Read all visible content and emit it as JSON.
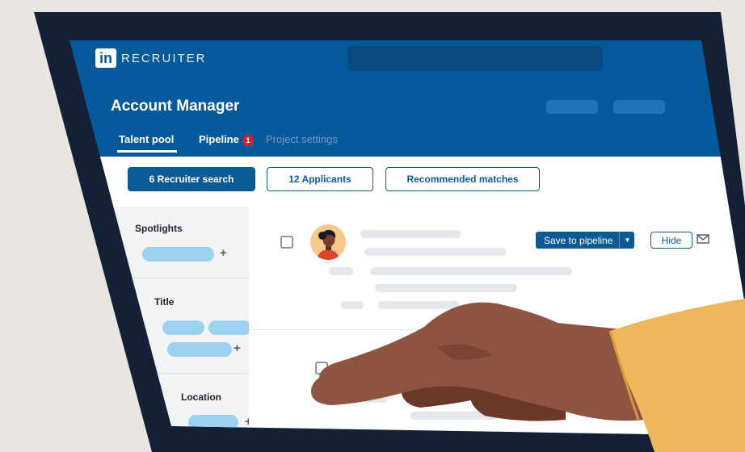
{
  "header": {
    "logo_mark": "in",
    "logo_word": "RECRUITER",
    "project_title": "Account Manager"
  },
  "tabs": [
    {
      "label": "Talent pool",
      "active": true
    },
    {
      "label": "Pipeline",
      "badge": "1"
    },
    {
      "label": "Project settings"
    }
  ],
  "filters": [
    {
      "label": "6 Recruiter search",
      "active": true
    },
    {
      "label": "12 Applicants"
    },
    {
      "label": "Recommended matches"
    }
  ],
  "sidebar": {
    "sections": [
      {
        "heading": "Spotlights"
      },
      {
        "heading": "Title"
      },
      {
        "heading": "Location"
      }
    ],
    "add_glyph": "+"
  },
  "candidate": {
    "save_label": "Save to pipeline",
    "hide_label": "Hide",
    "icons": [
      "caret-down-icon",
      "mail-icon"
    ]
  },
  "colors": {
    "brand_blue": "#06599a",
    "accent_blue": "#0b5a93",
    "pill_blue": "#9dd1f0",
    "badge_red": "#c8243b",
    "skin": "#8e5442",
    "sleeve": "#efb75b"
  }
}
